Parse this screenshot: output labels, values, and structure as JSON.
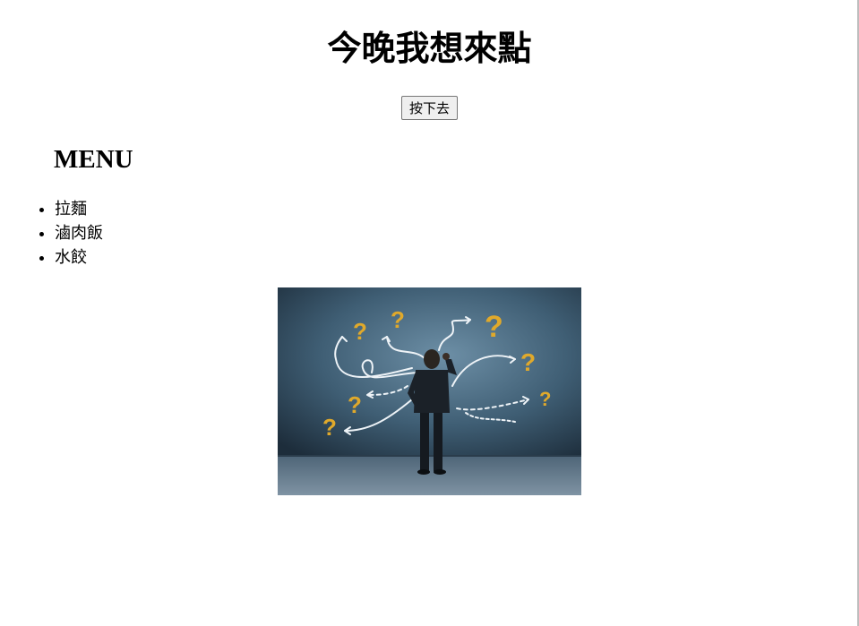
{
  "page": {
    "title": "今晚我想來點",
    "button_label": "按下去"
  },
  "menu": {
    "heading": "MENU",
    "items": [
      "拉麵",
      "滷肉飯",
      "水餃"
    ]
  },
  "illustration": {
    "icon": "man-with-question-marks-image",
    "question_mark_color": "#e0a92b",
    "wall_color": "#3f5e74"
  }
}
